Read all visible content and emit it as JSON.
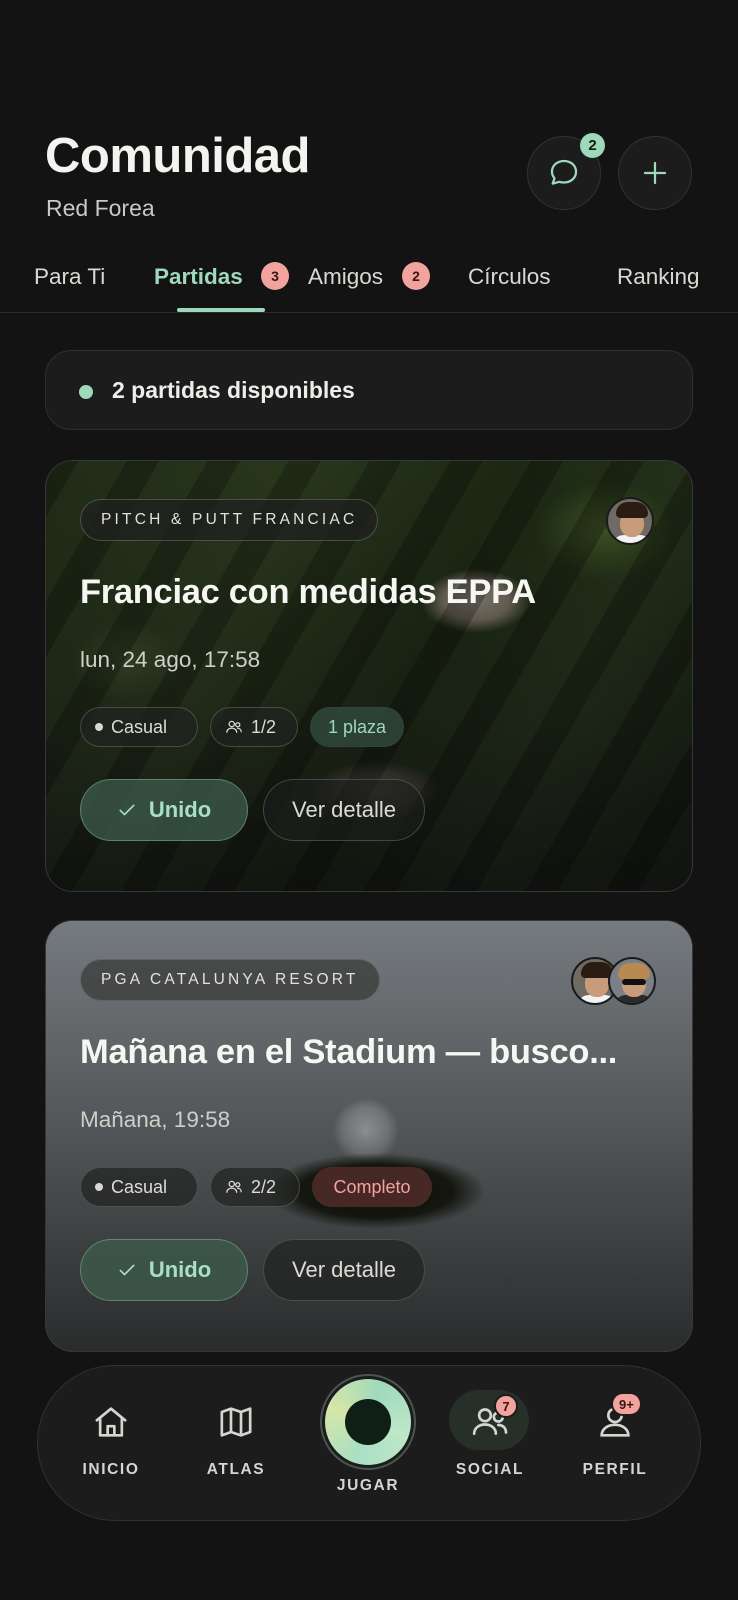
{
  "header": {
    "title": "Comunidad",
    "subtitle": "Red Forea",
    "chat_badge": "2",
    "chat_icon": "chat-bubble-icon",
    "add_icon": "plus-icon"
  },
  "tabs": [
    {
      "label": "Para Ti"
    },
    {
      "label": "Partidas",
      "badge": "3",
      "active": true
    },
    {
      "label": "Amigos",
      "badge": "2"
    },
    {
      "label": "Círculos"
    },
    {
      "label": "Ranking"
    }
  ],
  "availability": {
    "text": "2 partidas disponibles"
  },
  "matches": [
    {
      "venue": "PITCH & PUTT FRANCIAC",
      "title": "Franciac con medidas EPPA",
      "date": "lun, 24 ago, 17:58",
      "type": "Casual",
      "players": "1/2",
      "status": "1 plaza",
      "joined_label": "Unido",
      "detail_label": "Ver detalle"
    },
    {
      "venue": "PGA CATALUNYA RESORT",
      "title": "Mañana en el Stadium — busco...",
      "date": "Mañana, 19:58",
      "type": "Casual",
      "players": "2/2",
      "status": "Completo",
      "joined_label": "Unido",
      "detail_label": "Ver detalle"
    }
  ],
  "nav": {
    "home": {
      "label": "INICIO",
      "icon": "home-icon"
    },
    "atlas": {
      "label": "ATLAS",
      "icon": "map-icon"
    },
    "play": {
      "label": "JUGAR",
      "icon": "play-ring-icon"
    },
    "social": {
      "label": "SOCIAL",
      "icon": "people-icon",
      "badge": "7"
    },
    "profile": {
      "label": "PERFIL",
      "icon": "person-icon",
      "badge": "9+"
    }
  },
  "colors": {
    "accent": "#9fd9bc",
    "badge": "#f3a39d",
    "background": "#131313"
  }
}
